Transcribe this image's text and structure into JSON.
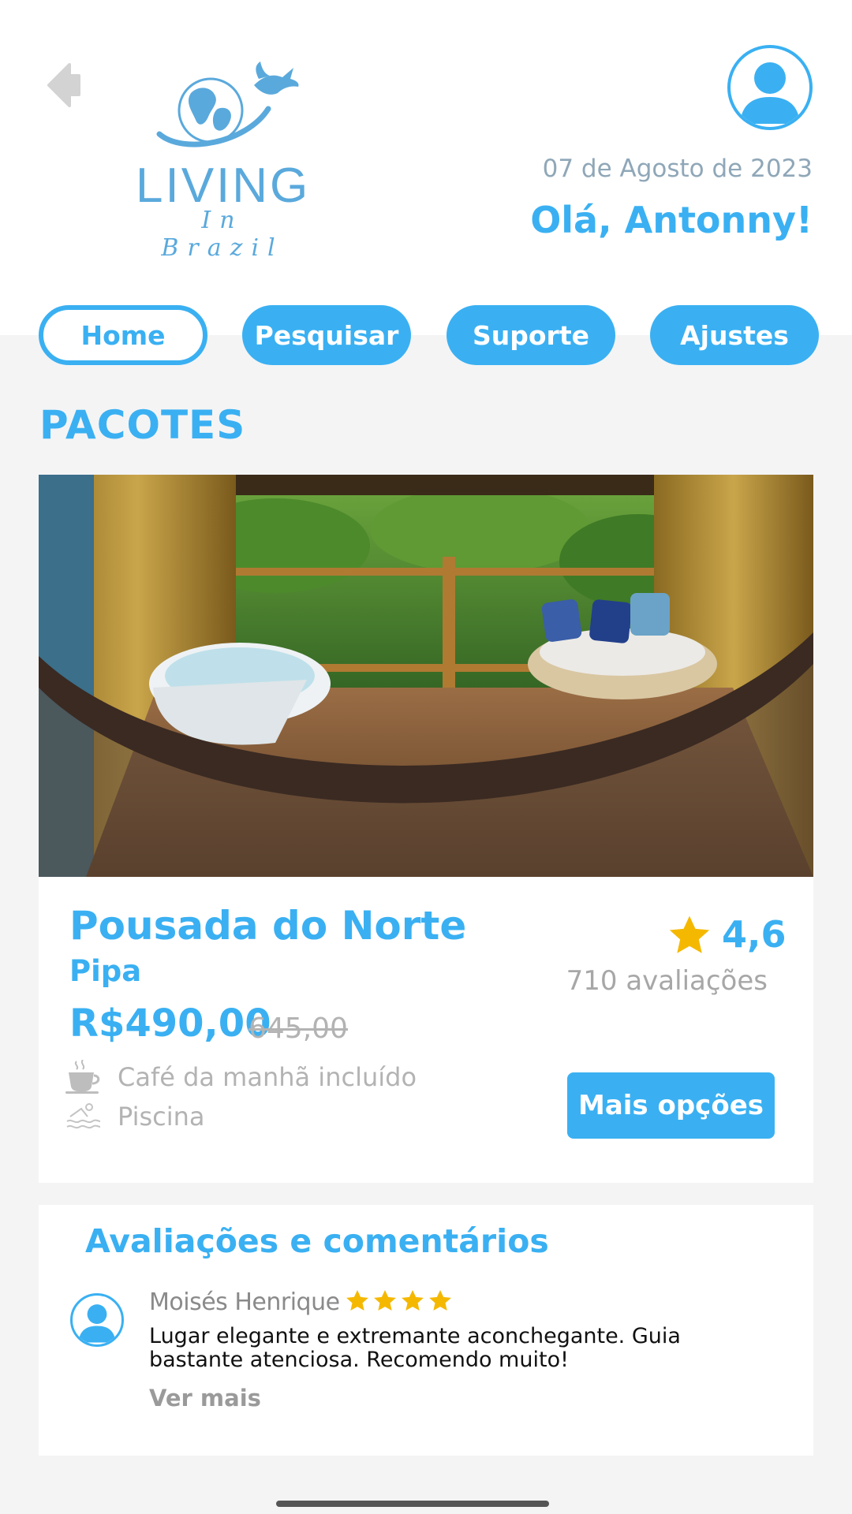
{
  "header": {
    "logo_main": "LIVING",
    "logo_sub": "In Brazil",
    "date": "07 de Agosto de 2023",
    "greeting": "Olá, Antonny!"
  },
  "tabs": [
    {
      "label": "Home",
      "active": true
    },
    {
      "label": "Pesquisar",
      "active": false
    },
    {
      "label": "Suporte",
      "active": false
    },
    {
      "label": "Ajustes",
      "active": false
    }
  ],
  "section_title": "PACOTES",
  "package": {
    "name": "Pousada do Norte",
    "city": "Pipa",
    "price": "R$490,00",
    "old_price": "645,00",
    "rating": "4,6",
    "rating_count": "710 avaliações",
    "amenities": [
      {
        "icon": "coffee-cup-icon",
        "label": "Café da manhã incluído"
      },
      {
        "icon": "pool-icon",
        "label": "Piscina"
      }
    ],
    "more_button": "Mais opções"
  },
  "reviews": {
    "title": "Avaliações e comentários",
    "items": [
      {
        "author": "Moisés Henrique",
        "stars": 4,
        "text": "Lugar elegante e extremante aconchegante. Guia bastante atenciosa. Recomendo muito!",
        "more": "Ver mais"
      }
    ]
  },
  "colors": {
    "accent": "#3ab0f2",
    "star": "#f5b800",
    "muted": "#b3b3b3",
    "background": "#f4f4f5"
  }
}
